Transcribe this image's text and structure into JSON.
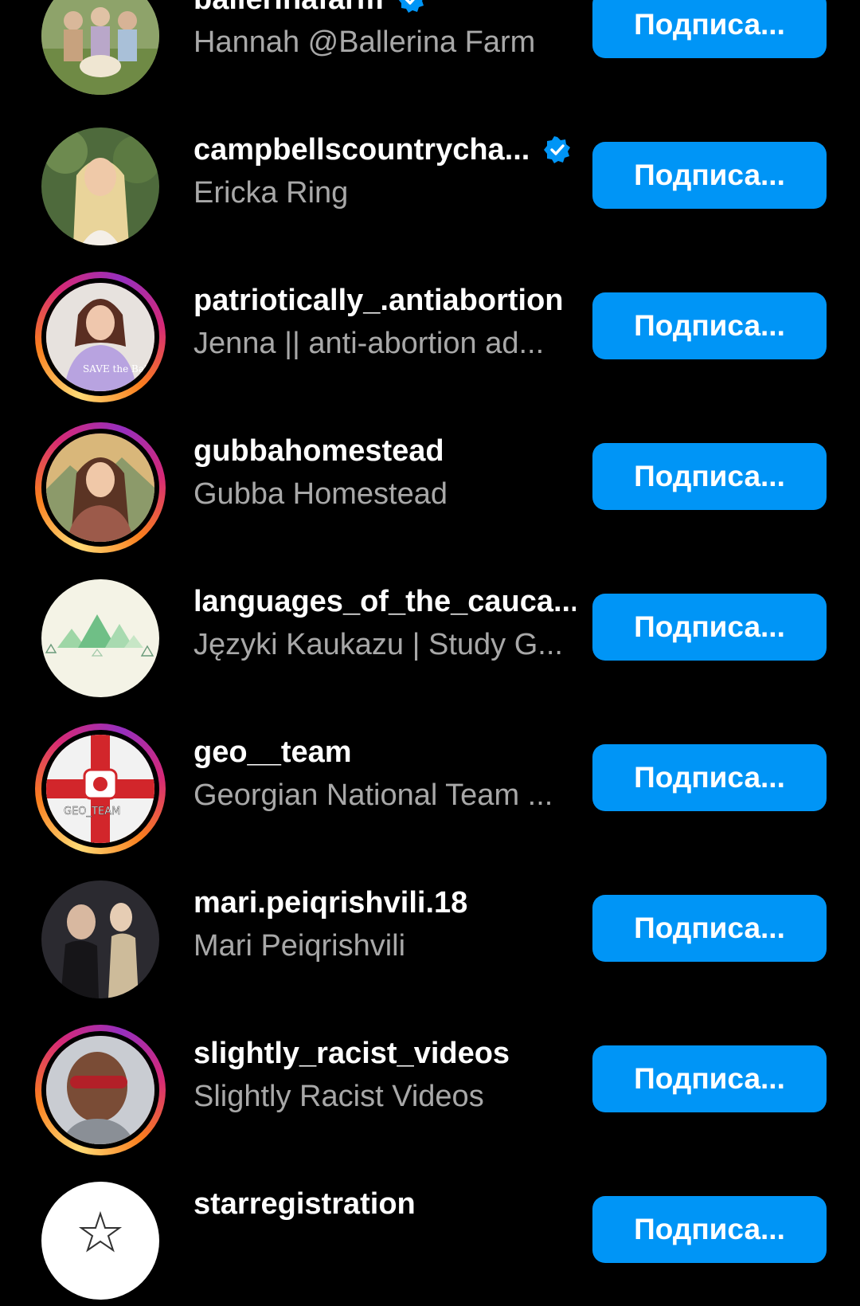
{
  "colors": {
    "background": "#000000",
    "button": "#0095f6",
    "secondary_text": "#a8a8a8",
    "verified": "#0095f6"
  },
  "accounts": [
    {
      "username": "ballerinafarm",
      "full_name": "Hannah @Ballerina Farm",
      "verified": true,
      "story_ring": false,
      "button_label": "Подписа..."
    },
    {
      "username": "campbellscountrycha...",
      "full_name": "Ericka Ring",
      "verified": true,
      "story_ring": false,
      "button_label": "Подписа..."
    },
    {
      "username": "patriotically_.antiabortion",
      "full_name": "Jenna || anti-abortion ad...",
      "verified": false,
      "story_ring": true,
      "button_label": "Подписа..."
    },
    {
      "username": "gubbahomestead",
      "full_name": "Gubba Homestead",
      "verified": false,
      "story_ring": true,
      "button_label": "Подписа..."
    },
    {
      "username": "languages_of_the_cauca...",
      "full_name": "Języki Kaukazu | Study G...",
      "verified": false,
      "story_ring": false,
      "button_label": "Подписа..."
    },
    {
      "username": "geo__team",
      "full_name": "Georgian National Team ...",
      "verified": false,
      "story_ring": true,
      "button_label": "Подписа..."
    },
    {
      "username": "mari.peiqrishvili.18",
      "full_name": "Mari Peiqrishvili",
      "verified": false,
      "story_ring": false,
      "button_label": "Подписа..."
    },
    {
      "username": "slightly_racist_videos",
      "full_name": "Slightly Racist Videos",
      "verified": false,
      "story_ring": true,
      "button_label": "Подписа..."
    },
    {
      "username": "starregistration",
      "full_name": "",
      "verified": false,
      "story_ring": false,
      "button_label": "Подписа..."
    }
  ],
  "avatar_logo_text": {
    "patriotically": "SAVE the Babies",
    "geo_team": "GEO_TEAM"
  }
}
